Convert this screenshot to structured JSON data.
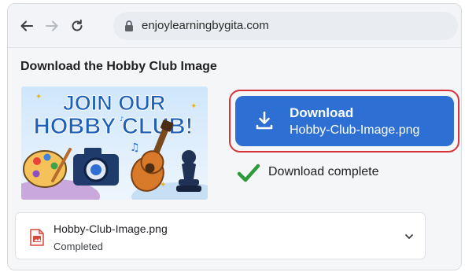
{
  "browser": {
    "url": "enjoylearningbygita.com",
    "icons": [
      "back-arrow-icon",
      "forward-arrow-icon",
      "reload-icon",
      "lock-icon"
    ]
  },
  "page": {
    "title": "Download the Hobby Club Image",
    "image": {
      "headline_line1": "JOIN OUR",
      "headline_line2": "HOBBY CLUB!"
    },
    "download_button": {
      "label": "Download",
      "filename": "Hobby-Club-Image.png",
      "icon": "download-icon"
    },
    "status_text": "Download complete"
  },
  "download_item": {
    "filename": "Hobby-Club-Image.png",
    "status": "Completed",
    "icon": "file-image-icon"
  },
  "colors": {
    "button_blue": "#2d6fd2",
    "highlight_red": "#d6333a",
    "check_green": "#2e9a3c"
  }
}
